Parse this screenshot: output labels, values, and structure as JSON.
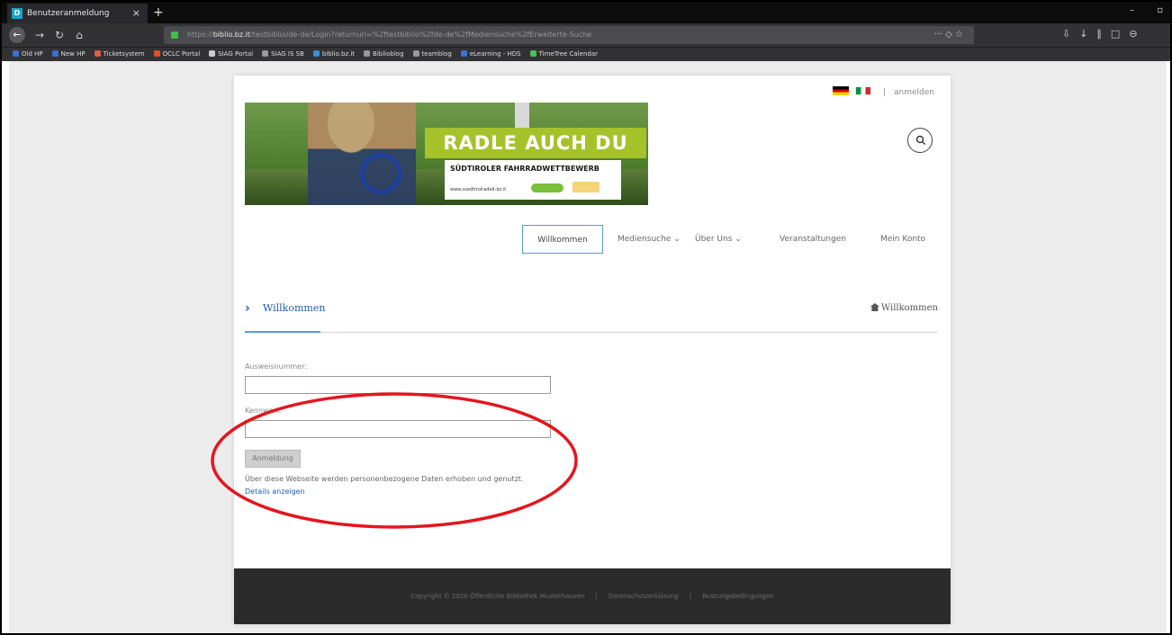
{
  "browser": {
    "tab_title": "Benutzeranmeldung",
    "tab_favicon_letter": "D",
    "new_tab_glyph": "+",
    "close_glyph": "×",
    "url_prefix": "https://",
    "url_host": "biblio.bz.it",
    "url_path": "/testbiblio/de-de/Login?returnurl=%2ftestbiblio%2fde-de%2fMediensuche%2fErweiterte-Suche",
    "bookmarks": [
      {
        "label": "Old HP",
        "color": "#3b6fd6"
      },
      {
        "label": "New HP",
        "color": "#3b6fd6"
      },
      {
        "label": "Ticketsystem",
        "color": "#e25c4a"
      },
      {
        "label": "OCLC Portal",
        "color": "#e0512b"
      },
      {
        "label": "SIAG Portal",
        "color": "#cccccc"
      },
      {
        "label": "SIAG IS SB",
        "color": "#999999"
      },
      {
        "label": "biblio.bz.it",
        "color": "#3a8fd6"
      },
      {
        "label": "Biblioblog",
        "color": "#999999"
      },
      {
        "label": "teamblog",
        "color": "#999999"
      },
      {
        "label": "eLearning - HDS",
        "color": "#3b6fd6"
      },
      {
        "label": "TimeTree Calendar",
        "color": "#4cbf5a"
      }
    ]
  },
  "header": {
    "lang_login": "anmelden",
    "banner_title": "RADLE AUCH DU MIT!",
    "banner_subtitle": "SÜDTIROLER FAHRRADWETTBEWERB",
    "banner_url": "www.suedtirolradelt.bz.it"
  },
  "nav": {
    "items": [
      "Willkommen",
      "Mediensuche ⌄",
      "Über Uns ⌄",
      "Veranstaltungen",
      "Mein Konto"
    ]
  },
  "page": {
    "title": "Willkommen",
    "breadcrumb": "Willkommen",
    "card_number_label": "Ausweisnummer:",
    "password_label": "Kennwort:",
    "login_button": "Anmeldung",
    "privacy_text": "Über diese Webseite werden personenbezogene Daten erhoben und genutzt.",
    "details_link": "Details anzeigen"
  },
  "footer": {
    "copyright": "Copyright © 2020 Öffentliche Bibliothek Mustethausen",
    "privacy": "Datenschutzerklärung",
    "terms": "Nutzungsbedingungen"
  },
  "colors": {
    "accent": "#1f5ea8",
    "annotation": "#e3161e",
    "banner_green": "#a6c22a",
    "footer_bg": "#2b2b2b"
  }
}
